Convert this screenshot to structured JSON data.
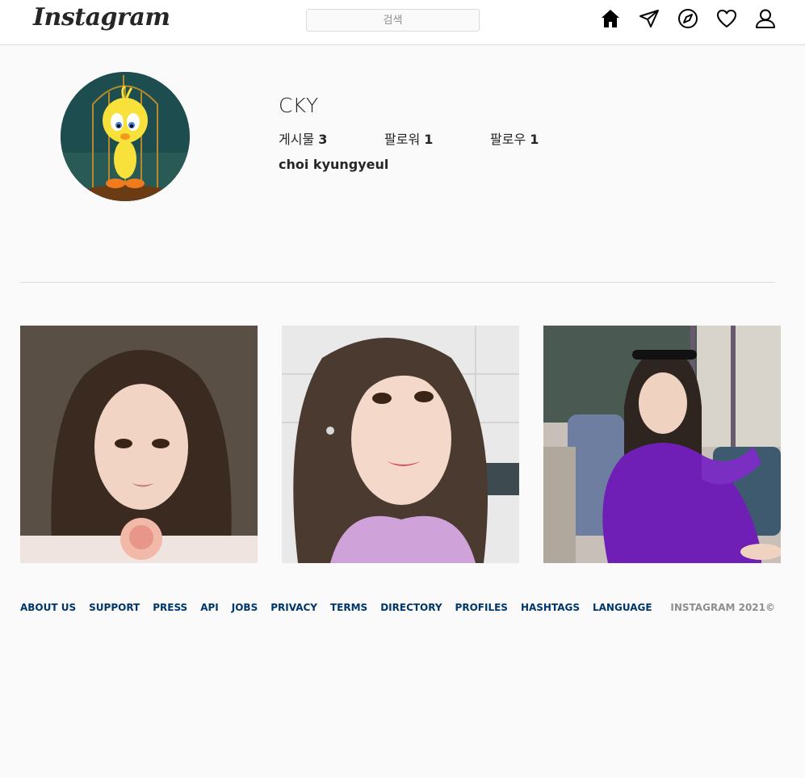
{
  "header": {
    "logo_text": "Instagram",
    "search_placeholder": "검색",
    "icons": [
      "home-icon",
      "direct-message-icon",
      "explore-icon",
      "activity-heart-icon",
      "profile-icon"
    ]
  },
  "profile": {
    "username": "CKY",
    "stats": [
      {
        "label": "게시물",
        "value": "3"
      },
      {
        "label": "팔로워",
        "value": "1"
      },
      {
        "label": "팔로우",
        "value": "1"
      }
    ],
    "full_name": "choi kyungyeul"
  },
  "posts": [
    {
      "name": "post-1"
    },
    {
      "name": "post-2"
    },
    {
      "name": "post-3"
    }
  ],
  "footer": {
    "links": [
      "ABOUT US",
      "SUPPORT",
      "PRESS",
      "API",
      "JOBS",
      "PRIVACY",
      "TERMS",
      "DIRECTORY",
      "PROFILES",
      "HASHTAGS",
      "LANGUAGE"
    ],
    "copyright": "INSTAGRAM 2021©"
  },
  "colors": {
    "background": "#fafafa",
    "link": "#00376b",
    "muted": "#8e8e8e",
    "border": "#dbdbdb"
  }
}
